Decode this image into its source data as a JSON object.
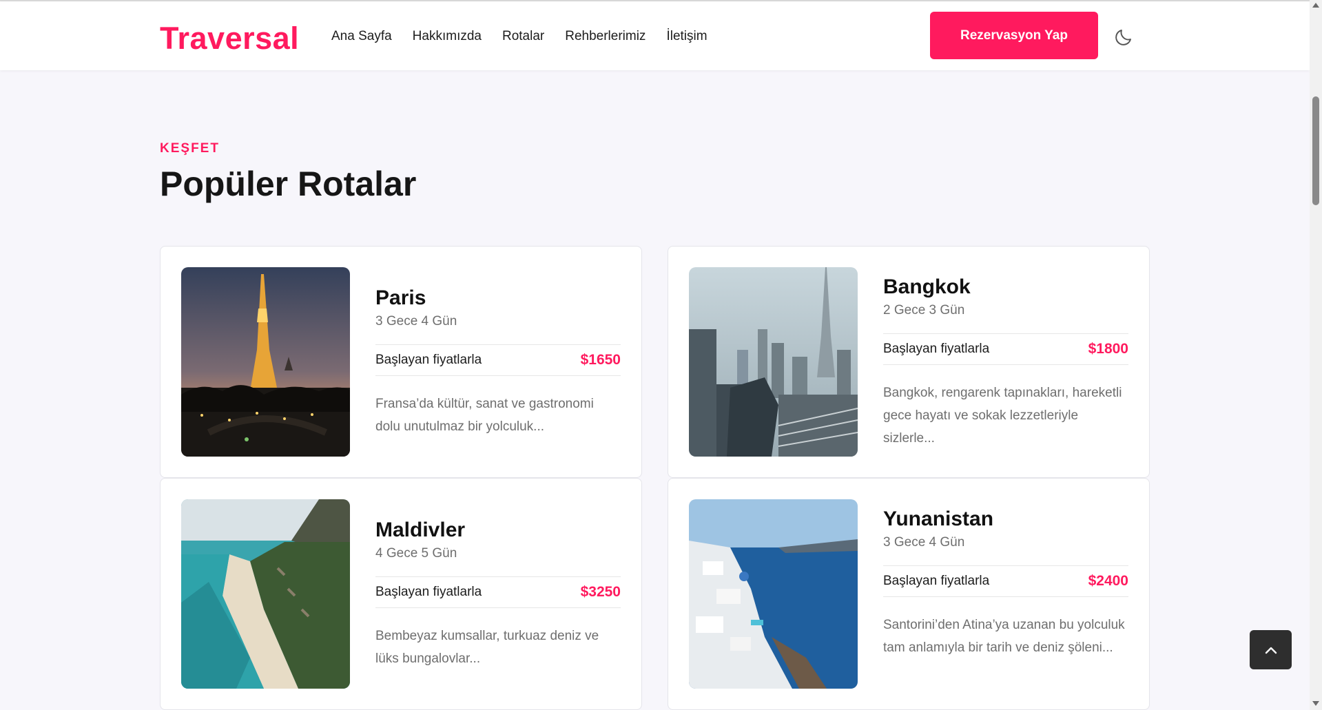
{
  "brand": {
    "name": "Traversal",
    "accent": "#ff1a5e"
  },
  "nav": {
    "items": [
      "Ana Sayfa",
      "Hakkımızda",
      "Rotalar",
      "Rehberlerimiz",
      "İletişim"
    ],
    "cta_label": "Rezervasyon Yap",
    "theme_icon": "moon-icon"
  },
  "section": {
    "eyebrow": "KEŞFET",
    "title": "Popüler Rotalar"
  },
  "tours": [
    {
      "city": "Paris",
      "duration": "3 Gece 4 Gün",
      "price_label": "Başlayan fiyatlarla",
      "price": "$1650",
      "description": "Fransa’da kültür, sanat ve gastronomi dolu unutulmaz bir yolculuk...",
      "image": "eiffel-tower-photo"
    },
    {
      "city": "Bangkok",
      "duration": "2 Gece 3 Gün",
      "price_label": "Başlayan fiyatlarla",
      "price": "$1800",
      "description": "Bangkok, rengarenk tapınakları, hareketli gece hayatı ve sokak lezzetleriyle sizlerle...",
      "image": "city-skyline-photo"
    },
    {
      "city": "Maldivler",
      "duration": "4 Gece 5 Gün",
      "price_label": "Başlayan fiyatlarla",
      "price": "$3250",
      "description": "Bembeyaz kumsallar, turkuaz deniz ve lüks bungalovlar...",
      "image": "beach-coast-photo"
    },
    {
      "city": "Yunanistan",
      "duration": "3 Gece 4 Gün",
      "price_label": "Başlayan fiyatlarla",
      "price": "$2400",
      "description": "Santorini’den Atina’ya uzanan bu yolculuk tam anlamıyla bir tarih ve deniz şöleni...",
      "image": "santorini-photo"
    }
  ],
  "back_to_top_icon": "chevron-up-icon"
}
